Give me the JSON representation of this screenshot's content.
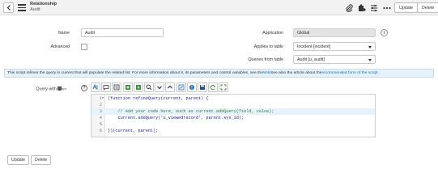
{
  "header": {
    "record_type": "Relationship",
    "record_name": "Audit",
    "update_label": "Update",
    "delete_label": "Delete"
  },
  "form": {
    "name_label": "Name",
    "name_value": "Audit",
    "advanced_label": "Advanced",
    "application_label": "Application",
    "application_value": "Global",
    "applies_to_label": "Applies to table",
    "applies_to_value": "Incident [incident]",
    "queries_from_label": "Queries from table",
    "queries_from_value": "Audit [u_audit]"
  },
  "banner": {
    "text_before": "This script refines the query in current that will populate the related list. For more information about it, its parameters and control variables, see the ",
    "wiki_link": "Wiki",
    "text_middle": " See also the article about the ",
    "article_link": "recommended form of the script.",
    "text_after": ""
  },
  "editor": {
    "label": "Query with",
    "lines": [
      {
        "num": "1",
        "fold": "▾",
        "text": "(function refineQuery(current, parent) {",
        "comment": false
      },
      {
        "num": "2",
        "fold": "",
        "text": "",
        "comment": false
      },
      {
        "num": "3",
        "fold": "",
        "text": "    // Add your code here, such as current.addQuery(field, value);",
        "comment": true
      },
      {
        "num": "4",
        "fold": "",
        "text": "    current.addQuery('u_viewedrecord', parent.sys_id);",
        "comment": false
      },
      {
        "num": "5",
        "fold": "",
        "text": "",
        "comment": false
      },
      {
        "num": "6",
        "fold": "",
        "text": "})(current, parent);",
        "comment": false
      }
    ]
  },
  "footer": {
    "update_label": "Update",
    "delete_label": "Delete"
  },
  "colors": {
    "header_bg": "#f2f2f2",
    "banner_bg": "#e5f1fb",
    "link": "#1f6fb5",
    "readonly_bg": "#e3e3e3"
  }
}
